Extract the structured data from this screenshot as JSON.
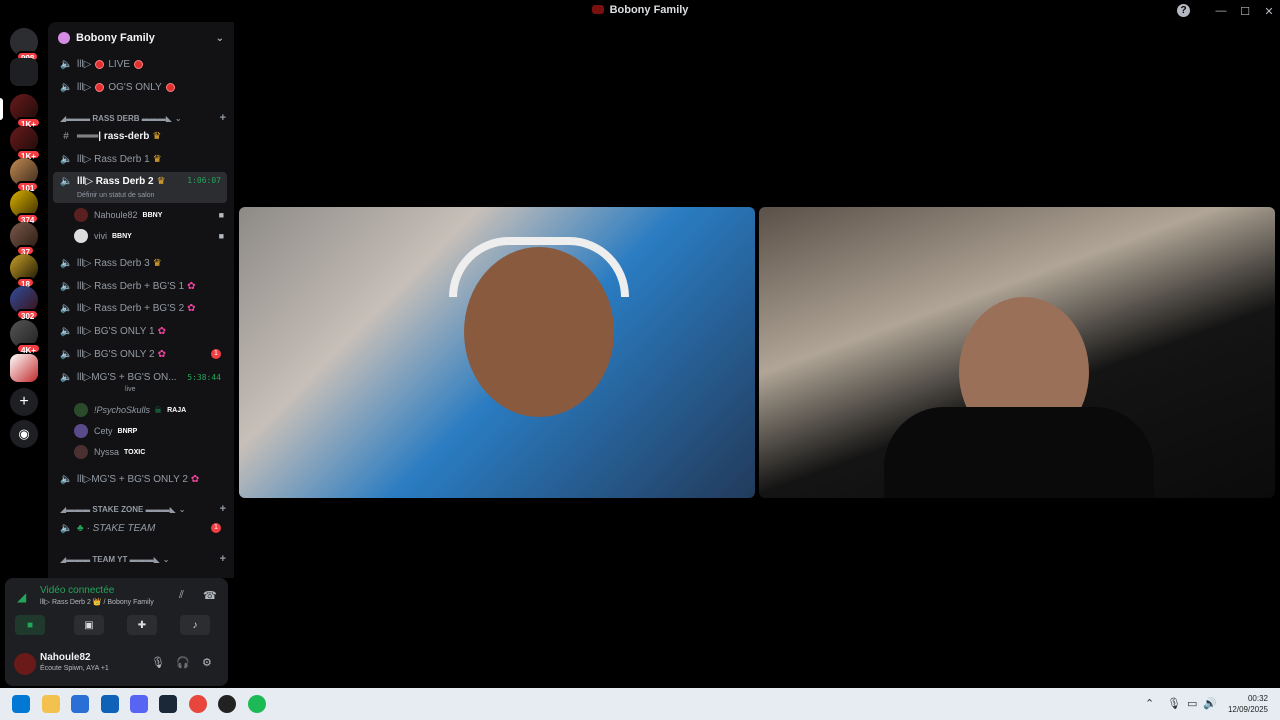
{
  "window": {
    "title": "Bobony Family"
  },
  "guilds": [
    {
      "badge": "998"
    },
    {
      "badge": ""
    },
    {
      "badge": "1K+"
    },
    {
      "badge": "1K+"
    },
    {
      "badge": "101"
    },
    {
      "badge": "374"
    },
    {
      "badge": "37"
    },
    {
      "badge": "18"
    },
    {
      "badge": "302"
    },
    {
      "badge": "4K+"
    }
  ],
  "server": {
    "name": "Bobony Family"
  },
  "channels": {
    "live": "lll▷",
    "live_label": "LIVE",
    "og_prefix": "lll▷",
    "og_label": "OG'S ONLY",
    "cat_rass": "◢▬▬▬ RASS DERB ▬▬▬◣",
    "rass_derb": "═══| rass-derb",
    "rd1": "lll▷ Rass Derb 1",
    "rd2": "lll▷ Rass Derb 2",
    "rd2_time": "1:06:07",
    "rd2_sub": "Définir un statut de salon",
    "user1": "Nahoule82",
    "user1_tag": "BBNY",
    "user2": "vivi",
    "user2_tag": "BBNY",
    "rd3": "lll▷ Rass Derb 3",
    "rdbg1": "lll▷ Rass Derb + BG'S 1",
    "rdbg2": "lll▷ Rass Derb + BG'S 2",
    "bg1": "lll▷ BG'S ONLY 1",
    "bg2": "lll▷ BG'S ONLY 2",
    "bg2_unread": "1",
    "mgbg": "lll▷MG'S + BG'S ON...",
    "mgbg_time": "5:38:44",
    "mgbg_sub": "live",
    "user3": "!PsychoSkulls",
    "user3_tag": "RAJA",
    "user4": "Cety",
    "user4_tag": "BNRP",
    "user5": "Nyssa",
    "user5_tag": "TOXIC",
    "mgbg2": "lll▷MG'S + BG'S ONLY 2",
    "cat_stake": "◢▬▬▬ STAKE ZONE ▬▬▬◣",
    "stake_team": "· STAKE TEAM",
    "stake_unread": "1",
    "cat_yt": "◢▬▬▬ TEAM YT ▬▬▬◣"
  },
  "voice": {
    "status": "Vidéo connectée",
    "sub": "lll▷ Rass Derb 2 👑 / Bobony Family"
  },
  "me": {
    "name": "Nahoule82",
    "status": "Écoute Spiwn, AYA +1"
  },
  "clock": {
    "time": "00:32",
    "date": "12/09/2025"
  },
  "colors": {
    "accent_green": "#23a55a",
    "danger": "#f23f43",
    "sidebar": "#121214"
  }
}
